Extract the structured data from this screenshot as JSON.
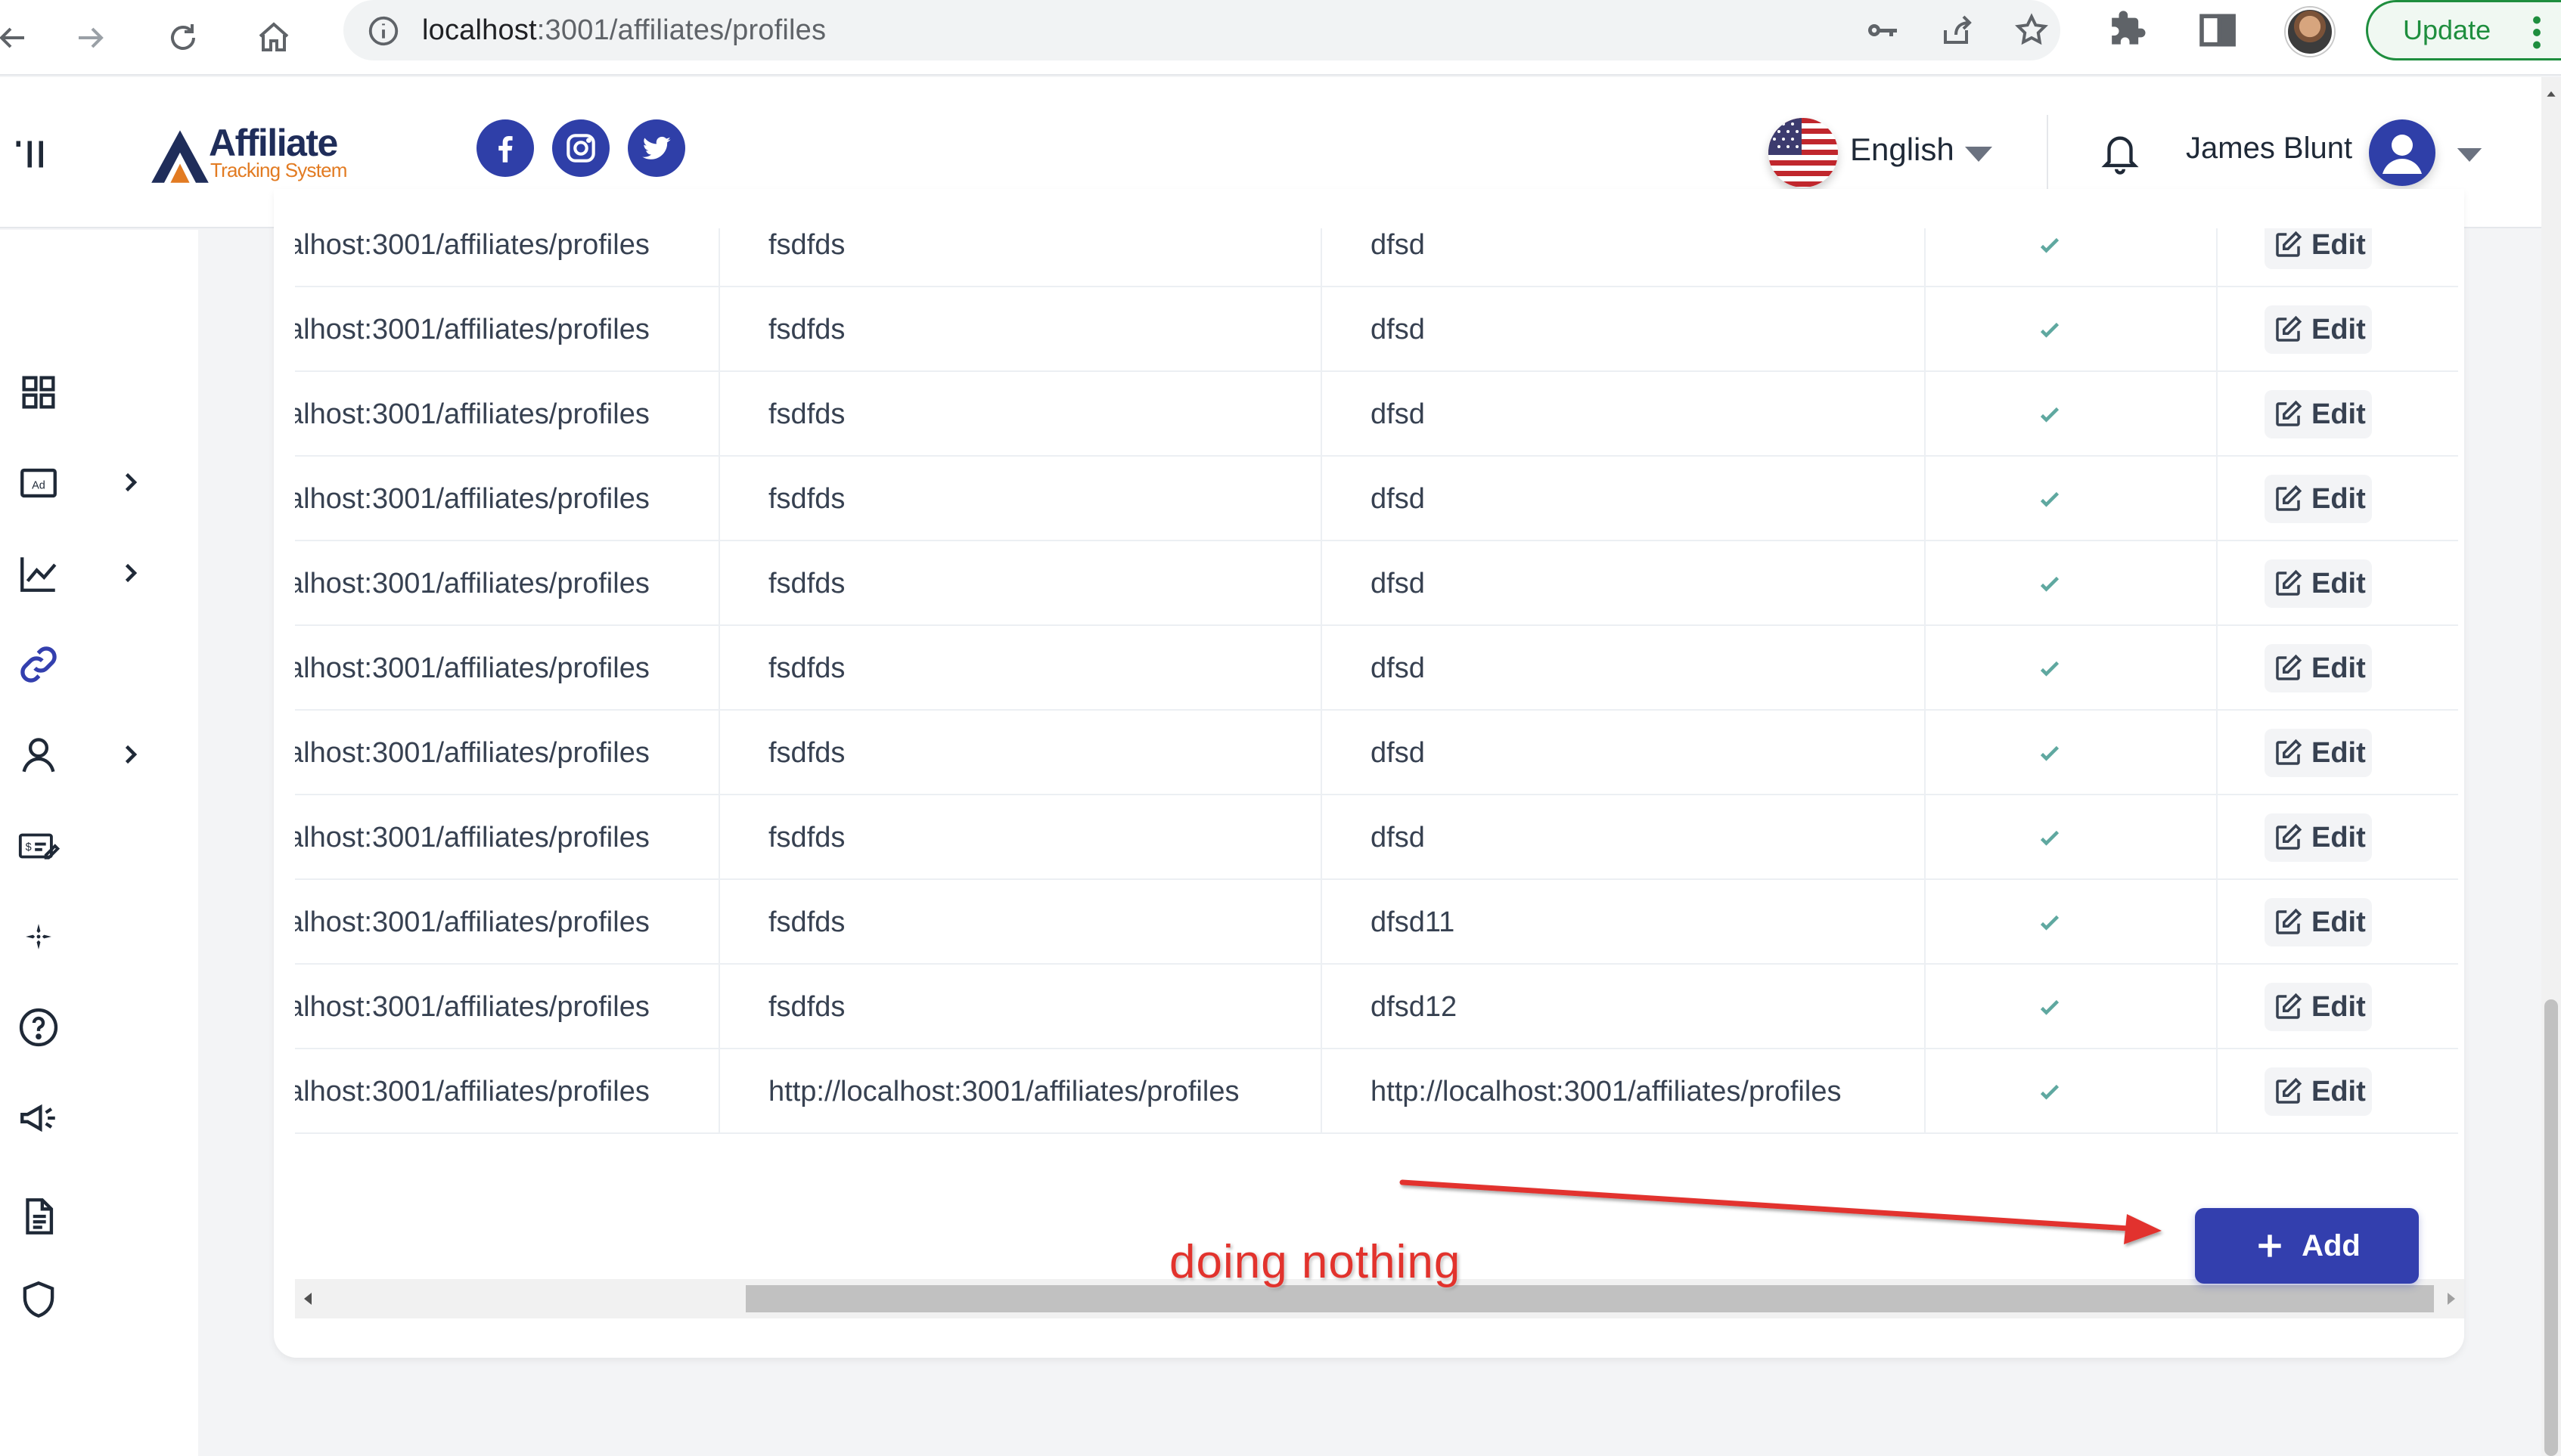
{
  "browser": {
    "url_host": "localhost",
    "url_rest": ":3001/affiliates/profiles",
    "update_label": "Update"
  },
  "header": {
    "logo_title": "Affiliate",
    "logo_subtitle": "Tracking System",
    "social": [
      "facebook-icon",
      "instagram-icon",
      "twitter-icon"
    ],
    "language": "English",
    "user_name": "James Blunt"
  },
  "sidebar": {
    "items": [
      {
        "icon": "dashboard-icon",
        "has_submenu": false
      },
      {
        "icon": "ad-icon",
        "has_submenu": true
      },
      {
        "icon": "chart-icon",
        "has_submenu": true
      },
      {
        "icon": "link-icon",
        "has_submenu": false,
        "active": true
      },
      {
        "icon": "user-icon",
        "has_submenu": true
      },
      {
        "icon": "payment-icon",
        "has_submenu": false
      },
      {
        "icon": "sparkle-icon",
        "has_submenu": false
      },
      {
        "icon": "help-icon",
        "has_submenu": false
      },
      {
        "icon": "megaphone-icon",
        "has_submenu": false
      },
      {
        "icon": "document-icon",
        "has_submenu": false
      },
      {
        "icon": "shield-icon",
        "has_submenu": false
      }
    ]
  },
  "table": {
    "rows": [
      {
        "url": "alhost:3001/affiliates/profiles",
        "col2": "fsdfds",
        "col3": "dfsd",
        "edit": "Edit"
      },
      {
        "url": "alhost:3001/affiliates/profiles",
        "col2": "fsdfds",
        "col3": "dfsd",
        "edit": "Edit"
      },
      {
        "url": "alhost:3001/affiliates/profiles",
        "col2": "fsdfds",
        "col3": "dfsd",
        "edit": "Edit"
      },
      {
        "url": "alhost:3001/affiliates/profiles",
        "col2": "fsdfds",
        "col3": "dfsd",
        "edit": "Edit"
      },
      {
        "url": "alhost:3001/affiliates/profiles",
        "col2": "fsdfds",
        "col3": "dfsd",
        "edit": "Edit"
      },
      {
        "url": "alhost:3001/affiliates/profiles",
        "col2": "fsdfds",
        "col3": "dfsd",
        "edit": "Edit"
      },
      {
        "url": "alhost:3001/affiliates/profiles",
        "col2": "fsdfds",
        "col3": "dfsd",
        "edit": "Edit"
      },
      {
        "url": "alhost:3001/affiliates/profiles",
        "col2": "fsdfds",
        "col3": "dfsd",
        "edit": "Edit"
      },
      {
        "url": "alhost:3001/affiliates/profiles",
        "col2": "fsdfds",
        "col3": "dfsd11",
        "edit": "Edit"
      },
      {
        "url": "alhost:3001/affiliates/profiles",
        "col2": "fsdfds",
        "col3": "dfsd12",
        "edit": "Edit"
      },
      {
        "url": "alhost:3001/affiliates/profiles",
        "col2": "http://localhost:3001/affiliates/profiles",
        "col3": "http://localhost:3001/affiliates/profiles",
        "edit": "Edit"
      }
    ]
  },
  "actions": {
    "add_label": "Add"
  },
  "annotation": {
    "text": "doing nothing"
  },
  "colors": {
    "primary": "#333fae",
    "check": "#5fa8a0",
    "annotation": "#e2332d"
  }
}
